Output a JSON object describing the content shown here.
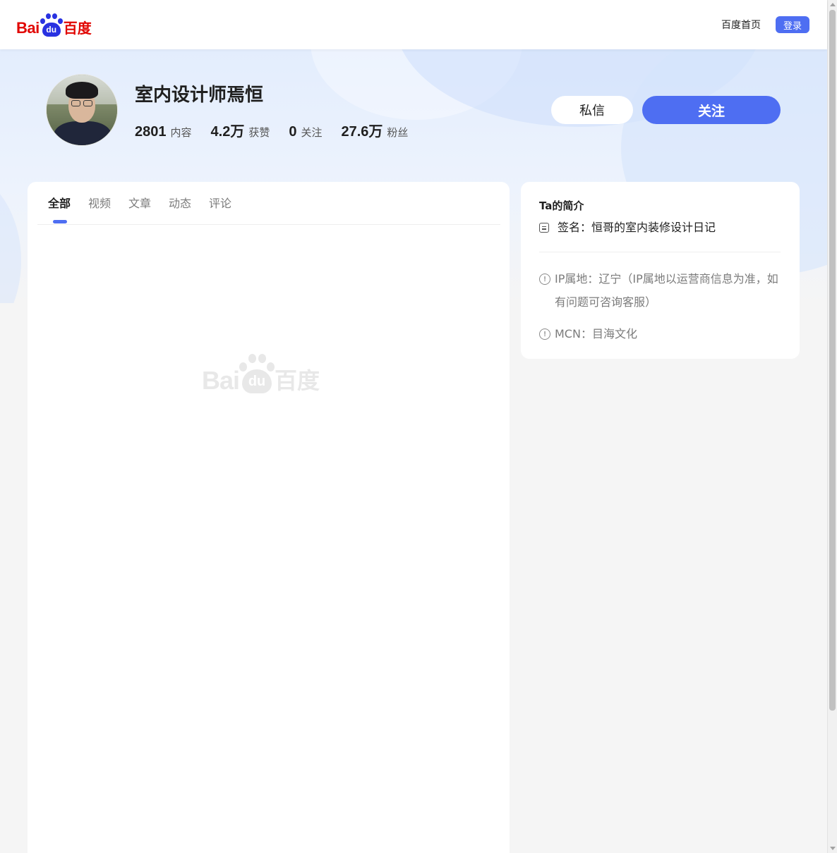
{
  "header": {
    "logo": {
      "latin": "Bai",
      "paw": "du",
      "chinese": "百度"
    },
    "home_link": "百度首页",
    "login_label": "登录"
  },
  "profile": {
    "name": "室内设计师焉恒",
    "stats": [
      {
        "value": "2801",
        "label": "内容"
      },
      {
        "value": "4.2万",
        "label": "获赞"
      },
      {
        "value": "0",
        "label": "关注"
      },
      {
        "value": "27.6万",
        "label": "粉丝"
      }
    ],
    "message_label": "私信",
    "follow_label": "关注"
  },
  "tabs": [
    {
      "label": "全部",
      "active": true
    },
    {
      "label": "视频",
      "active": false
    },
    {
      "label": "文章",
      "active": false
    },
    {
      "label": "动态",
      "active": false
    },
    {
      "label": "评论",
      "active": false
    }
  ],
  "watermark": {
    "latin": "Bai",
    "paw": "du",
    "chinese": "百度"
  },
  "sidebar": {
    "title": "Ta的简介",
    "signature": "签名：恒哥的室内装修设计日记",
    "ip": "IP属地：辽宁（IP属地以运营商信息为准，如有问题可咨询客服）",
    "mcn": "MCN：目海文化",
    "info_icon_glyph": "!"
  },
  "colors": {
    "accent": "#4e6ef2",
    "brand_red": "#e10602",
    "brand_blue": "#2932e1"
  }
}
